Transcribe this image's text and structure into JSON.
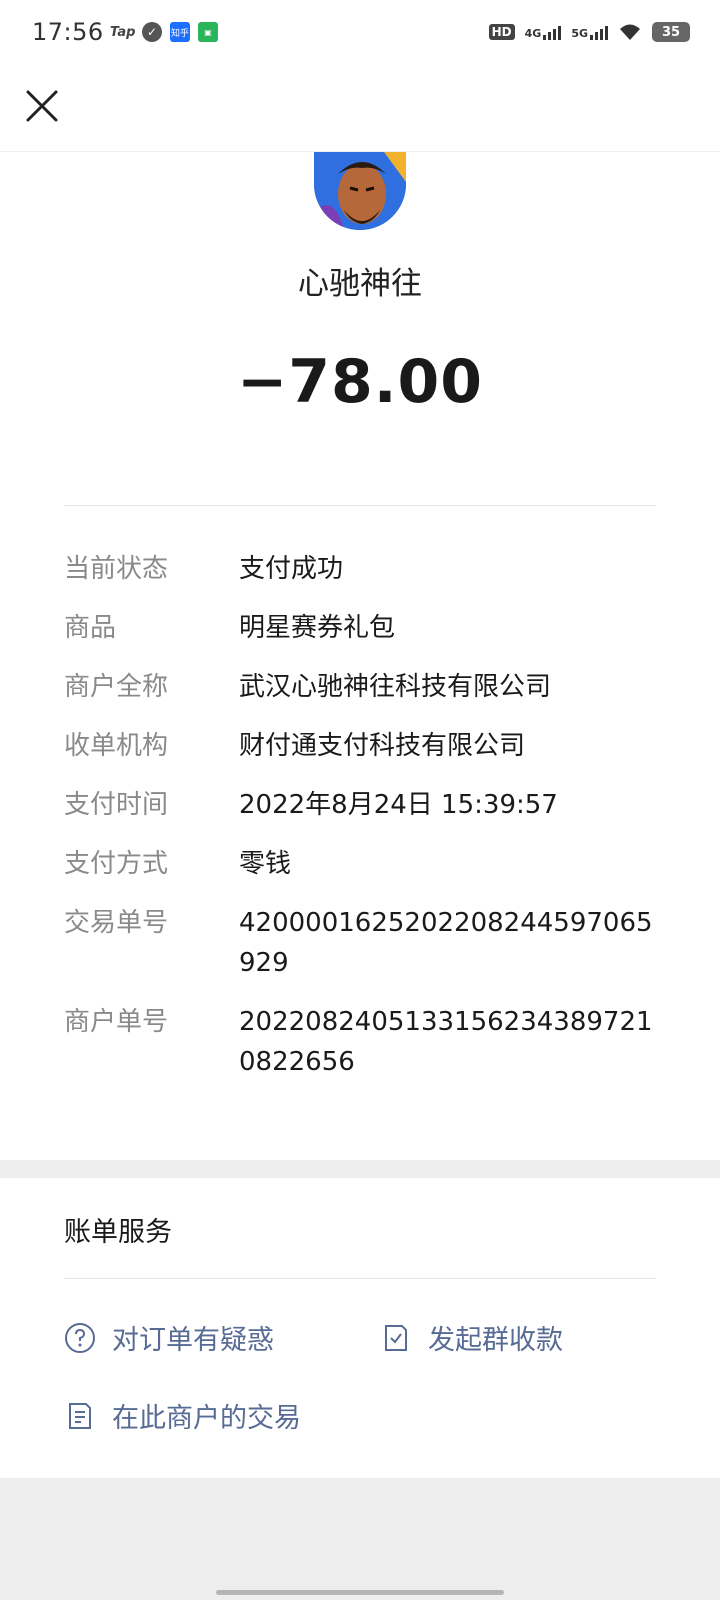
{
  "status_bar": {
    "time": "17:56",
    "app_icons": [
      "tap-icon",
      "check-icon",
      "zhihu-icon",
      "green-app-icon"
    ],
    "tap_text": "Tap",
    "zhihu_text": "知乎",
    "hd_text": "HD",
    "net1": "4G",
    "net2": "5G",
    "battery": "35"
  },
  "nav": {
    "close_icon": "close-icon"
  },
  "merchant": {
    "name": "心驰神往",
    "amount": "−78.00"
  },
  "details": [
    {
      "label": "当前状态",
      "value": "支付成功"
    },
    {
      "label": "商品",
      "value": "明星赛券礼包"
    },
    {
      "label": "商户全称",
      "value": "武汉心驰神往科技有限公司"
    },
    {
      "label": "收单机构",
      "value": "财付通支付科技有限公司"
    },
    {
      "label": "支付时间",
      "value": "2022年8月24日 15:39:57"
    },
    {
      "label": "支付方式",
      "value": "零钱"
    },
    {
      "label": "交易单号",
      "value": "4200001625202208244597065929"
    },
    {
      "label": "商户单号",
      "value": "2022082405133156234389721 0822656"
    }
  ],
  "services": {
    "title": "账单服务",
    "order_question": "对订单有疑惑",
    "group_collect": "发起群收款",
    "merchant_trades": "在此商户的交易"
  },
  "colors": {
    "link": "#576b95",
    "label": "#8a8a8a",
    "background": "#ededed"
  }
}
